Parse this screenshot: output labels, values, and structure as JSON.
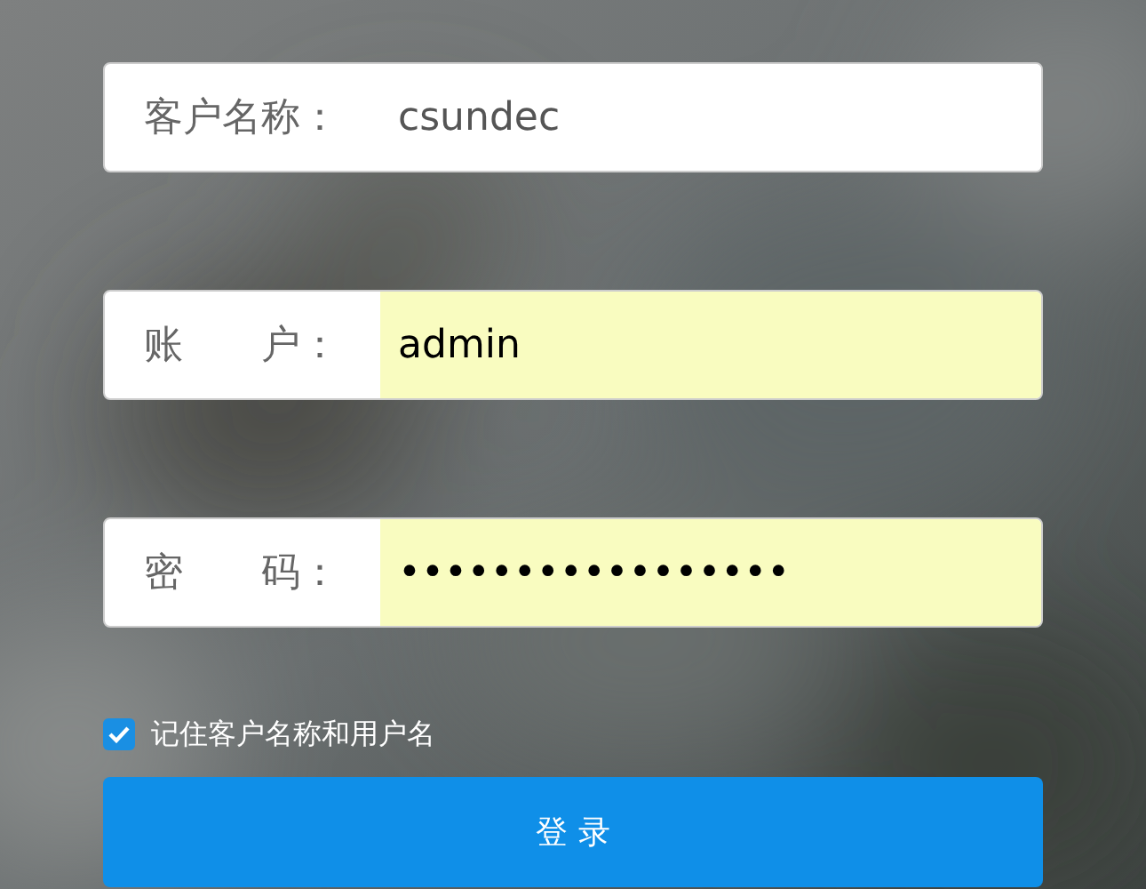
{
  "fields": [
    {
      "label": "客户名称：",
      "value": "csundec",
      "autofilled": false
    },
    {
      "label": "账　　户：",
      "value": "admin",
      "autofilled": true
    },
    {
      "label": "密　　码：",
      "value": "•••••••••••••••••",
      "autofilled": true
    }
  ],
  "remember": {
    "label": "记住客户名称和用户名",
    "checked": true
  },
  "login_button": "登 录"
}
